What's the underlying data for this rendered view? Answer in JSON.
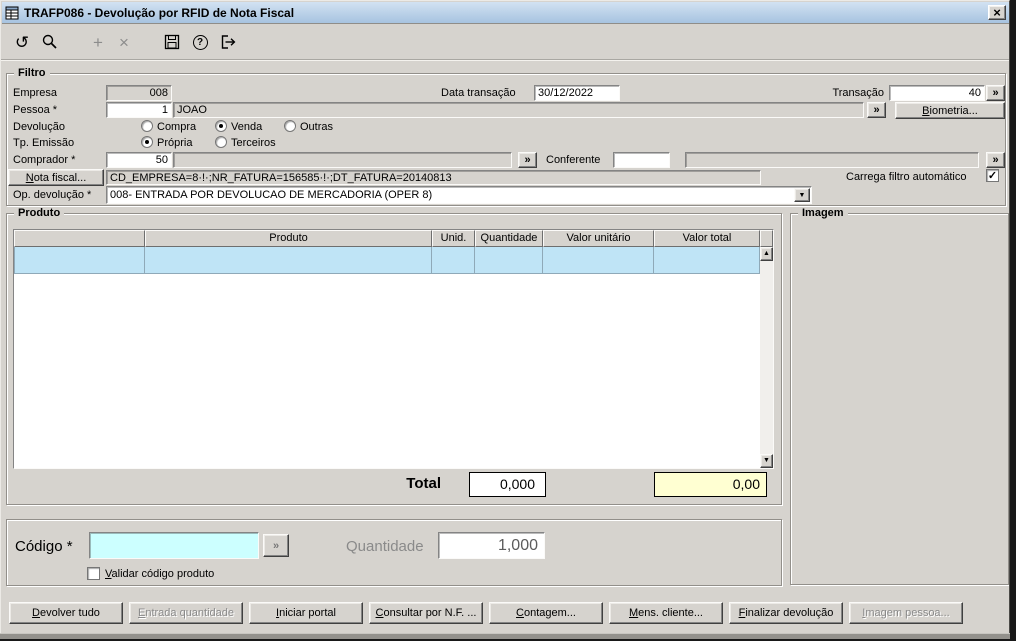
{
  "window": {
    "title": "TRAFP086 - Devolução por RFID de Nota Fiscal",
    "close_glyph": "×"
  },
  "glyphs": {
    "undo": "↺",
    "add": "+",
    "delete": "×",
    "help": "?",
    "lookup": "»",
    "dropdown_arrow": "▼",
    "scroll_up": "▲",
    "scroll_down": "▼"
  },
  "filtro": {
    "legend": "Filtro",
    "empresa": {
      "label": "Empresa",
      "value": "008"
    },
    "data_transacao": {
      "label": "Data transação",
      "value": "30/12/2022"
    },
    "transacao": {
      "label": "Transação",
      "value": "40"
    },
    "pessoa": {
      "label": "Pessoa *",
      "code": "1",
      "name": "JOAO"
    },
    "biometria_label": "Biometria...",
    "devolucao": {
      "label": "Devolução",
      "options": [
        "Compra",
        "Venda",
        "Outras"
      ],
      "selected": "Venda"
    },
    "tp_emissao": {
      "label": "Tp. Emissão",
      "options": [
        "Própria",
        "Terceiros"
      ],
      "selected": "Própria"
    },
    "comprador": {
      "label": "Comprador *",
      "code": "50",
      "name": ""
    },
    "conferente": {
      "label": "Conferente",
      "code": "",
      "name": ""
    },
    "nota_fiscal": {
      "button": "Nota fiscal...",
      "value": "CD_EMPRESA=8·!·;NR_FATURA=156585·!·;DT_FATURA=20140813"
    },
    "carrega_filtro": {
      "label": "Carrega filtro automático",
      "checked": true
    },
    "op_devolucao": {
      "label": "Op. devolução *",
      "value": "008- ENTRADA POR DEVOLUCAO DE MERCADORIA (OPER 8)"
    }
  },
  "produto": {
    "legend": "Produto",
    "columns": [
      "",
      "Produto",
      "Unid.",
      "Quantidade",
      "Valor unitário",
      "Valor total"
    ],
    "total": {
      "label": "Total",
      "quantidade": "0,000",
      "valor": "0,00"
    }
  },
  "imagem": {
    "legend": "Imagem"
  },
  "codigo": {
    "label": "Código *",
    "value": "",
    "quantidade_label": "Quantidade",
    "quantidade_value": "1,000",
    "validar": {
      "label": "Validar código produto",
      "checked": false
    }
  },
  "actions": {
    "devolver_tudo": {
      "label": "Devolver tudo",
      "enabled": true
    },
    "entrada_quantidade": {
      "label": "Entrada quantidade",
      "enabled": false
    },
    "iniciar_portal": {
      "label": "Iniciar portal",
      "enabled": true
    },
    "consultar_nf": {
      "label": "Consultar por N.F. ...",
      "enabled": true
    },
    "contagem": {
      "label": "Contagem...",
      "enabled": true
    },
    "mens_cliente": {
      "label": "Mens. cliente...",
      "enabled": true
    },
    "finalizar": {
      "label": "Finalizar devolução",
      "enabled": true
    },
    "imagem_pessoa": {
      "label": "Imagem pessoa...",
      "enabled": false
    }
  }
}
